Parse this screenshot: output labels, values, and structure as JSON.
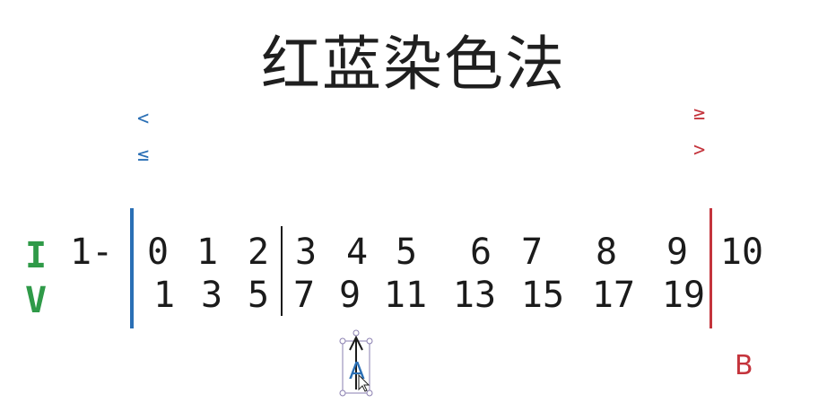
{
  "title": "红蓝染色法",
  "labels": {
    "i": "I",
    "v": "V",
    "b": "B",
    "prefix": "1-"
  },
  "symbols": {
    "blue_lt": "<",
    "blue_le": "≤",
    "red_ge": "≥",
    "red_gt": ">"
  },
  "indices": [
    "0",
    "1",
    "2",
    "3",
    "4",
    "5",
    "6",
    "7",
    "8",
    "9",
    "10"
  ],
  "values": [
    "1",
    "3",
    "5",
    "7",
    "9",
    "11",
    "13",
    "15",
    "17",
    "19"
  ],
  "colors": {
    "blue": "#2a6fb5",
    "red": "#c4343c",
    "green": "#2f9a48",
    "pointer": "#2a6fb5"
  }
}
